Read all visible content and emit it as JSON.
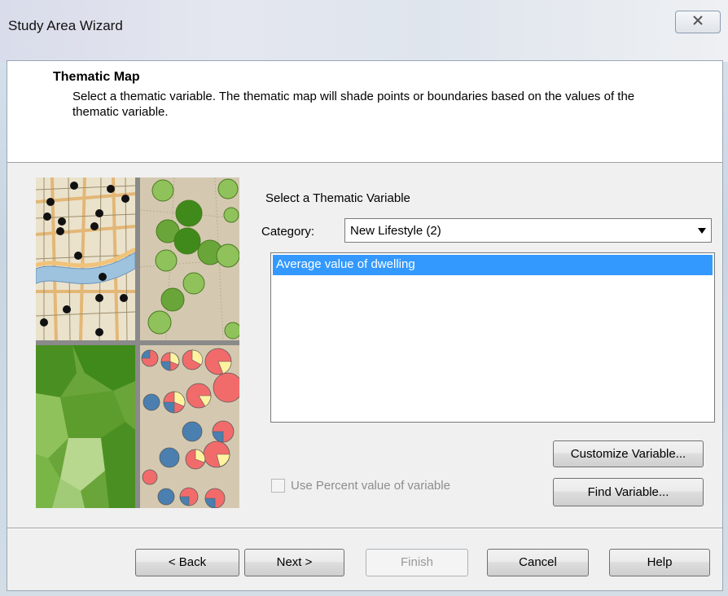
{
  "window": {
    "title": "Study Area Wizard",
    "close_glyph": "✕"
  },
  "header": {
    "title": "Thematic Map",
    "description": "Select a thematic variable.  The thematic map will shade points or boundaries based on the values of the thematic variable."
  },
  "form": {
    "section_label": "Select a Thematic Variable",
    "category_label": "Category:",
    "category_value": "New Lifestyle (2)",
    "variables": [
      "Average value of dwelling"
    ],
    "selected_variable_index": 0,
    "use_percent_label": "Use Percent value of variable",
    "use_percent_checked": false,
    "use_percent_enabled": false,
    "customize_button": "Customize Variable...",
    "find_button": "Find Variable..."
  },
  "footer": {
    "back": "< Back",
    "next": "Next >",
    "finish": "Finish",
    "finish_enabled": false,
    "cancel": "Cancel",
    "help": "Help"
  },
  "colors": {
    "selection": "#3399ff",
    "map_green_dark": "#3f8a1a",
    "map_green_light": "#8fc25a",
    "pie_red": "#f26b6b",
    "pie_blue": "#4a7fb0",
    "pie_yellow": "#fff3a0"
  }
}
